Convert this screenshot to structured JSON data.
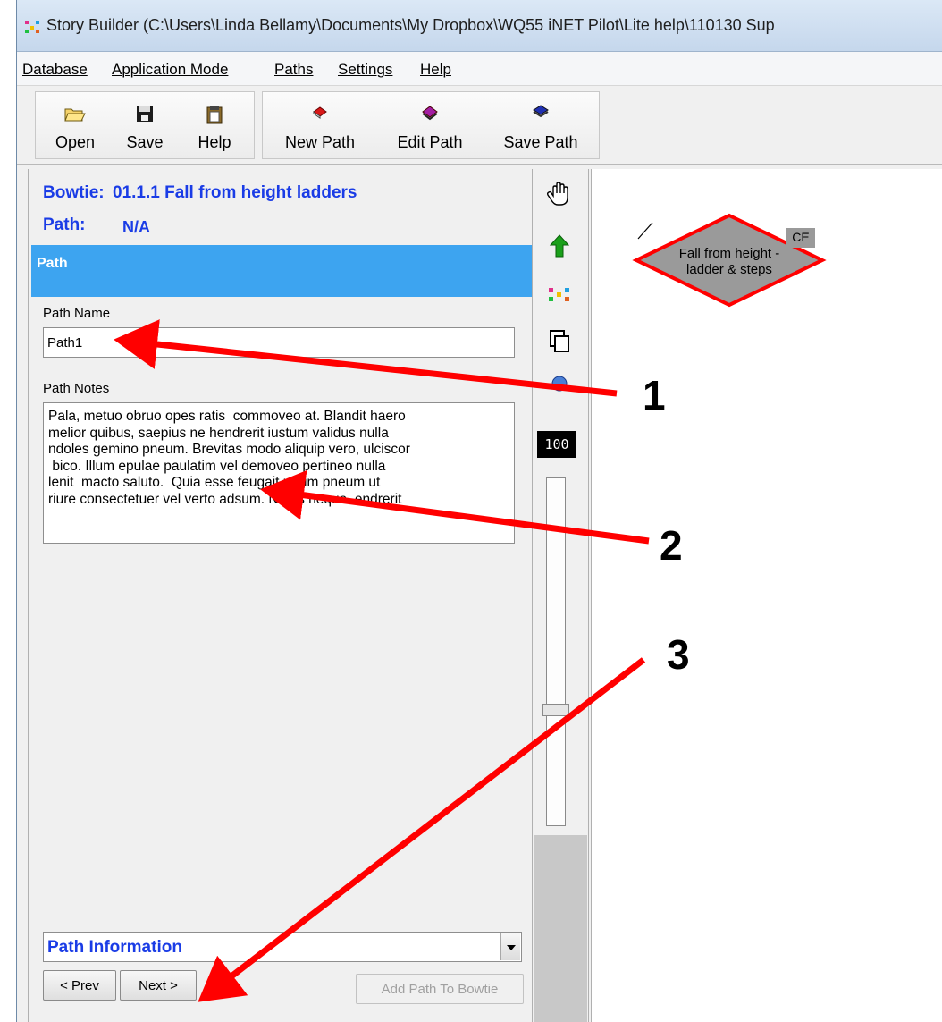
{
  "window": {
    "title": "Story Builder (C:\\Users\\Linda Bellamy\\Documents\\My Dropbox\\WQ55 iNET Pilot\\Lite help\\110130 Sup"
  },
  "menu": [
    "Database",
    "Application Mode",
    "Paths",
    "Settings",
    "Help"
  ],
  "toolbar": {
    "open": "Open",
    "save": "Save",
    "help": "Help",
    "new_path": "New Path",
    "edit_path": "Edit Path",
    "save_path": "Save Path"
  },
  "panel": {
    "bowtie_label": "Bowtie:",
    "bowtie_value": "01.1.1 Fall from height ladders",
    "path_label": "Path:",
    "path_value": "N/A",
    "section_title": "Path",
    "path_name_label": "Path Name",
    "path_name_value": "Path1",
    "path_notes_label": "Path Notes",
    "path_notes_value": "Pala, metuo obruo opes ratis  commoveo at. Blandit haero\nmelior quibus, saepius ne hendrerit iustum validus nulla\nndoles gemino pneum. Brevitas modo aliquip vero, ulciscor\n bico. Illum epulae paulatim vel demoveo pertineo nulla\nlenit  macto saluto.  Quia esse feugait utrum pneum ut\nriure consectetuer vel verto adsum. Nutus neque  endrerit",
    "info_select": "Path Information",
    "prev": "< Prev",
    "next": "Next >",
    "add_path": "Add Path To Bowtie"
  },
  "sidebar": {
    "zoom": "100",
    "icons": [
      "hand-icon",
      "up-arrow-icon",
      "multicolor-icon",
      "copy-icon",
      "globe-icon"
    ]
  },
  "canvas": {
    "node_line1": "Fall from height -",
    "node_line2": "ladder & steps",
    "node_badge": "CE"
  },
  "callouts": [
    "1",
    "2",
    "3"
  ],
  "colors": {
    "accent_blue": "#1a3ce6",
    "band_blue": "#3da4f0",
    "arrow_red": "#ff0000",
    "node_gray": "#9a9a9a"
  }
}
